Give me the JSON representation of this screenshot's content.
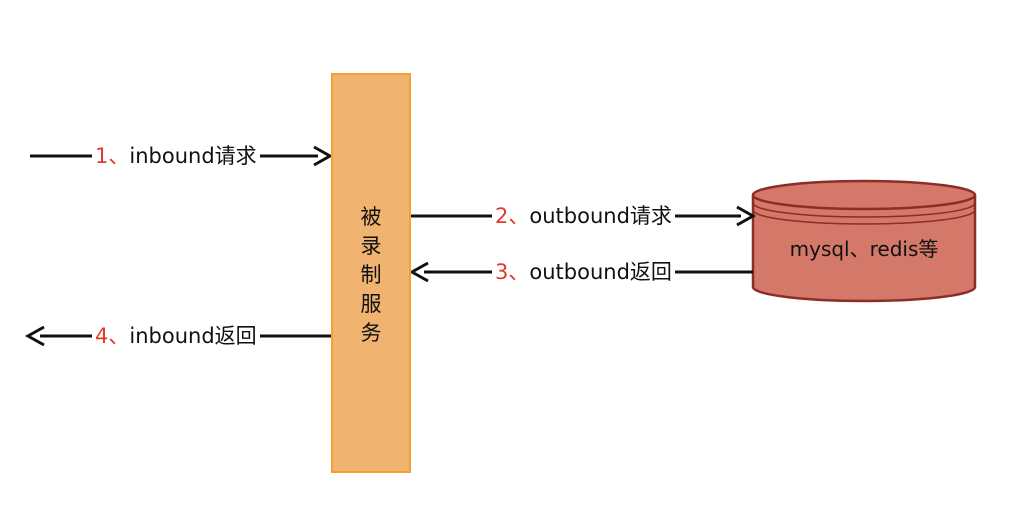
{
  "service": {
    "label": "被录制服务"
  },
  "database": {
    "label": "mysql、redis等"
  },
  "arrows": [
    {
      "num": "1、",
      "text": "inbound请求"
    },
    {
      "num": "2、",
      "text": "outbound请求"
    },
    {
      "num": "3、",
      "text": "outbound返回"
    },
    {
      "num": "4、",
      "text": "inbound返回"
    }
  ],
  "colors": {
    "service_fill": "#f0b470",
    "service_border": "#f5a031",
    "db_fill": "#d4786a",
    "db_border": "#8c2d26",
    "step_number": "#e03a2c",
    "arrow": "#111111"
  }
}
